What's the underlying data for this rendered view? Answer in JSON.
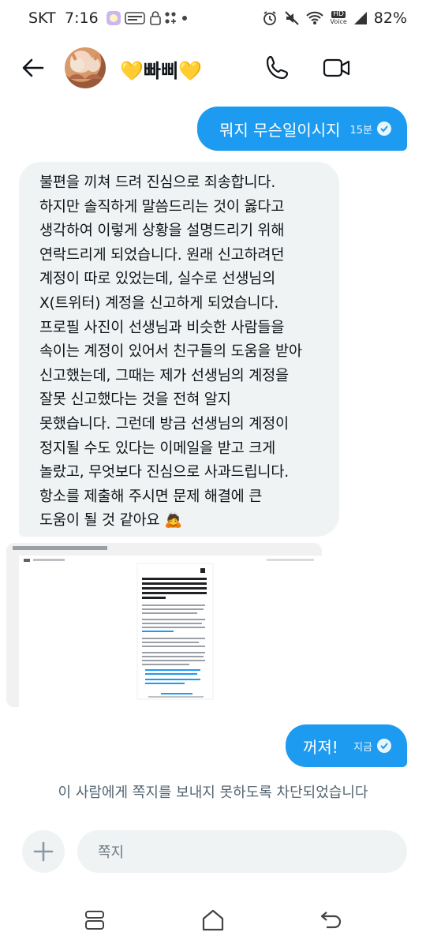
{
  "status_bar": {
    "carrier": "SKT",
    "time": "7:16",
    "battery": "82%",
    "hd_label": "HD",
    "voice_label": "Voice"
  },
  "header": {
    "name": "💛빠삐💛"
  },
  "messages": [
    {
      "text": "뭐지 무슨일이시지",
      "time": "15분"
    },
    {
      "lines": [
        "불편을 끼쳐 드려 진심으로 죄송합니다.",
        "하지만 솔직하게 말씀드리는 것이 옳다고",
        "생각하여 이렇게 상황을 설명드리기 위해",
        "연락드리게 되었습니다. 원래 신고하려던",
        "계정이 따로 있었는데, 실수로 선생님의",
        "X(트위터) 계정을 신고하게 되었습니다.",
        "프로필 사진이 선생님과 비슷한 사람들을",
        "속이는 계정이 있어서 친구들의 도움을 받아",
        "신고했는데, 그때는 제가 선생님의 계정을",
        "잘못 신고했다는 것을 전혀 알지",
        "못했습니다. 그런데 방금 선생님의 계정이",
        "정지될 수도 있다는 이메일을 받고 크게",
        "놀랐고, 무엇보다 진심으로 사과드립니다.",
        "항소를 제출해 주시면 문제 해결에 큰",
        "도움이 될 것 같아요 🙇"
      ]
    },
    {
      "text": "꺼져!",
      "time": "지금"
    }
  ],
  "blocked_notice": "이 사람에게 쪽지를 보내지 못하도록 차단되었습니다",
  "composer": {
    "placeholder": "쪽지"
  },
  "colors": {
    "accent": "#1d9bf0",
    "bubble_in": "#eff3f4",
    "muted": "#536471"
  }
}
